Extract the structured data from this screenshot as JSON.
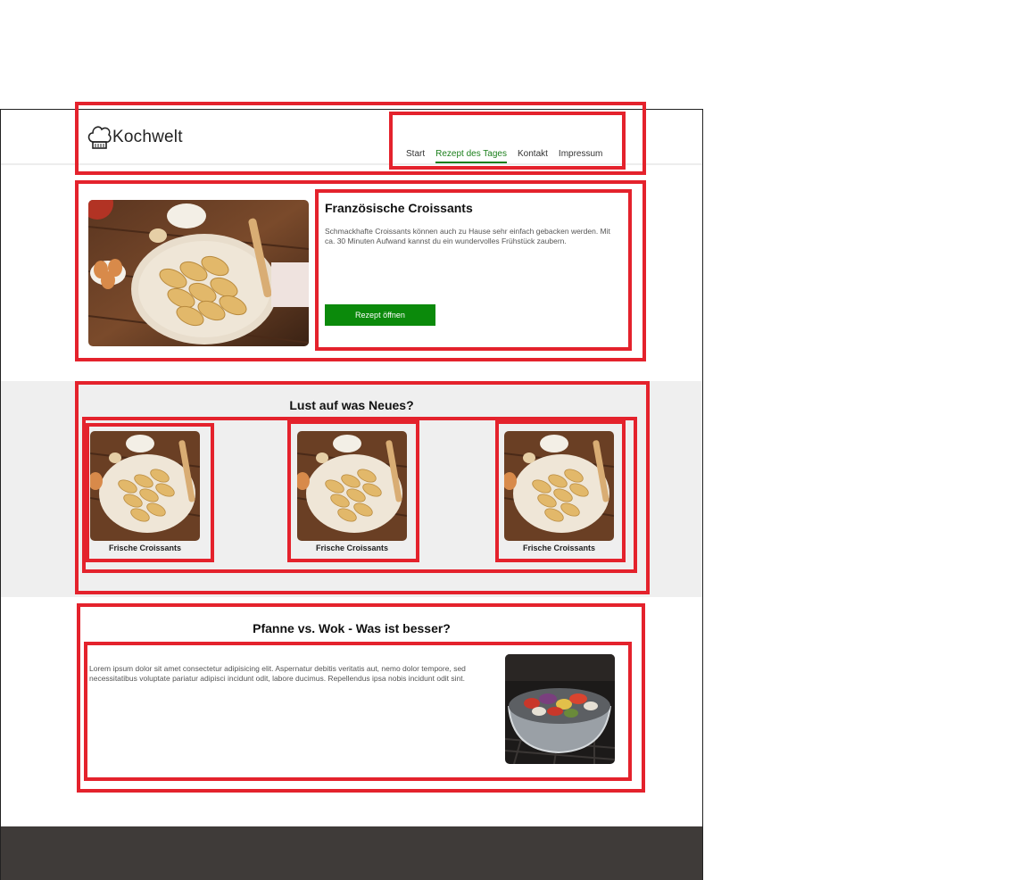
{
  "brand": {
    "name": "Kochwelt"
  },
  "nav": {
    "items": [
      {
        "label": "Start",
        "active": false
      },
      {
        "label": "Rezept des Tages",
        "active": true
      },
      {
        "label": "Kontakt",
        "active": false
      },
      {
        "label": "Impressum",
        "active": false
      }
    ]
  },
  "hero": {
    "title": "Französische Croissants",
    "text": "Schmackhafte Croissants können auch zu Hause sehr einfach gebacken werden. Mit ca. 30 Minuten Aufwand kannst du ein wundervolles Frühstück zaubern.",
    "button_label": "Rezept öffnen"
  },
  "suggestions": {
    "title": "Lust auf was Neues?",
    "cards": [
      {
        "label": "Frische Croissants"
      },
      {
        "label": "Frische Croissants"
      },
      {
        "label": "Frische Croissants"
      }
    ]
  },
  "article": {
    "title": "Pfanne vs. Wok - Was ist besser?",
    "text": "Lorem ipsum dolor sit amet consectetur adipisicing elit. Aspernatur debitis veritatis aut, nemo dolor tempore, sed necessitatibus voluptate pariatur adipisci incidunt odit, labore ducimus. Repellendus ipsa nobis incidunt odit sint."
  },
  "colors": {
    "accent": "#0b8a0b",
    "annotation": "#e4222c",
    "band": "#efefef",
    "footer": "#3f3b39"
  }
}
